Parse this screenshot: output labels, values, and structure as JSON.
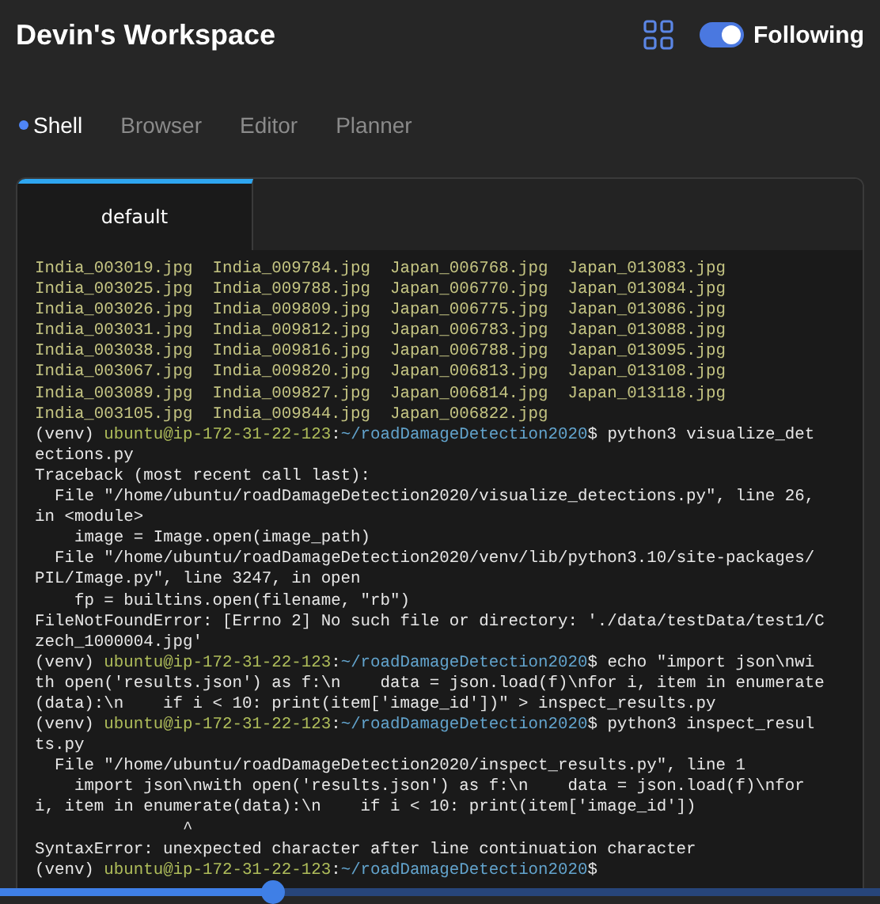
{
  "header": {
    "title": "Devin's Workspace",
    "following": {
      "label": "Following",
      "on": true
    }
  },
  "tabs": [
    {
      "label": "Shell",
      "selected": true
    },
    {
      "label": "Browser",
      "selected": false
    },
    {
      "label": "Editor",
      "selected": false
    },
    {
      "label": "Planner",
      "selected": false
    }
  ],
  "terminal": {
    "tabs": [
      {
        "label": "default",
        "selected": true
      }
    ],
    "lines": [
      {
        "kind": "files",
        "text": "India_003019.jpg  India_009784.jpg  Japan_006768.jpg  Japan_013083.jpg"
      },
      {
        "kind": "files",
        "text": "India_003025.jpg  India_009788.jpg  Japan_006770.jpg  Japan_013084.jpg"
      },
      {
        "kind": "files",
        "text": "India_003026.jpg  India_009809.jpg  Japan_006775.jpg  Japan_013086.jpg"
      },
      {
        "kind": "files",
        "text": "India_003031.jpg  India_009812.jpg  Japan_006783.jpg  Japan_013088.jpg"
      },
      {
        "kind": "files",
        "text": "India_003038.jpg  India_009816.jpg  Japan_006788.jpg  Japan_013095.jpg"
      },
      {
        "kind": "files",
        "text": "India_003067.jpg  India_009820.jpg  Japan_006813.jpg  Japan_013108.jpg"
      },
      {
        "kind": "files",
        "text": "India_003089.jpg  India_009827.jpg  Japan_006814.jpg  Japan_013118.jpg"
      },
      {
        "kind": "files",
        "text": "India_003105.jpg  India_009844.jpg  Japan_006822.jpg"
      },
      {
        "kind": "prompt",
        "parts": [
          {
            "kind": "plain",
            "text": "(venv) "
          },
          {
            "kind": "user",
            "text": "ubuntu@ip-172-31-22-123"
          },
          {
            "kind": "plain",
            "text": ":"
          },
          {
            "kind": "path",
            "text": "~/roadDamageDetection2020"
          },
          {
            "kind": "plain",
            "text": "$ python3 visualize_detections.py"
          }
        ]
      },
      {
        "kind": "output",
        "text": "Traceback (most recent call last):"
      },
      {
        "kind": "output",
        "text": "  File \"/home/ubuntu/roadDamageDetection2020/visualize_detections.py\", line 26,"
      },
      {
        "kind": "output",
        "text": "in <module>"
      },
      {
        "kind": "output",
        "text": "    image = Image.open(image_path)"
      },
      {
        "kind": "output",
        "text": "  File \"/home/ubuntu/roadDamageDetection2020/venv/lib/python3.10/site-packages/PIL/Image.py\", line 3247, in open"
      },
      {
        "kind": "output",
        "text": "    fp = builtins.open(filename, \"rb\")"
      },
      {
        "kind": "output",
        "text": "FileNotFoundError: [Errno 2] No such file or directory: './data/testData/test1/Czech_1000004.jpg'"
      },
      {
        "kind": "prompt",
        "parts": [
          {
            "kind": "plain",
            "text": "(venv) "
          },
          {
            "kind": "user",
            "text": "ubuntu@ip-172-31-22-123"
          },
          {
            "kind": "plain",
            "text": ":"
          },
          {
            "kind": "path",
            "text": "~/roadDamageDetection2020"
          },
          {
            "kind": "plain",
            "text": "$ echo \"import json\\nwith open('results.json') as f:\\n    data = json.load(f)\\nfor i, item in enumerate(data):\\n    if i < 10: print(item['image_id'])\" > inspect_results.py"
          }
        ]
      },
      {
        "kind": "prompt",
        "parts": [
          {
            "kind": "plain",
            "text": "(venv) "
          },
          {
            "kind": "user",
            "text": "ubuntu@ip-172-31-22-123"
          },
          {
            "kind": "plain",
            "text": ":"
          },
          {
            "kind": "path",
            "text": "~/roadDamageDetection2020"
          },
          {
            "kind": "plain",
            "text": "$ python3 inspect_results.py"
          }
        ]
      },
      {
        "kind": "output",
        "text": "  File \"/home/ubuntu/roadDamageDetection2020/inspect_results.py\", line 1"
      },
      {
        "kind": "output",
        "text": "    import json\\nwith open('results.json') as f:\\n    data = json.load(f)\\nfor i, item in enumerate(data):\\n    if i < 10: print(item['image_id'])"
      },
      {
        "kind": "output",
        "text": "               ^"
      },
      {
        "kind": "output",
        "text": "SyntaxError: unexpected character after line continuation character"
      },
      {
        "kind": "prompt",
        "parts": [
          {
            "kind": "plain",
            "text": "(venv) "
          },
          {
            "kind": "user",
            "text": "ubuntu@ip-172-31-22-123"
          },
          {
            "kind": "plain",
            "text": ":"
          },
          {
            "kind": "path",
            "text": "~/roadDamageDetection2020"
          },
          {
            "kind": "plain",
            "text": "$"
          }
        ]
      }
    ]
  },
  "progress": {
    "level": 0.31
  }
}
